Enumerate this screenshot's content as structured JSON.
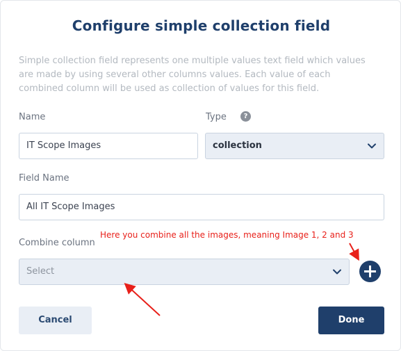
{
  "dialog": {
    "title": "Configure simple collection field",
    "description": "Simple collection field represents one multiple values text field which values are made by using several other columns values. Each value of each combined column will be used as collection of values for this field."
  },
  "form": {
    "name_label": "Name",
    "name_value": "IT Scope Images",
    "type_label": "Type",
    "type_value": "collection",
    "field_name_label": "Field Name",
    "field_name_value": "All IT Scope Images",
    "combine_label": "Combine column",
    "combine_placeholder": "Select"
  },
  "annotation": {
    "text": "Here you combine all the images, meaning Image 1, 2 and 3",
    "color": "#e8201a"
  },
  "buttons": {
    "cancel": "Cancel",
    "done": "Done"
  },
  "icons": {
    "help": "question-circle-icon",
    "help_glyph": "?",
    "chevron": "chevron-down-icon",
    "add": "plus-circle-icon"
  },
  "colors": {
    "primary": "#1f3f6b",
    "select_bg": "#e9eef5",
    "annotation": "#e8201a"
  }
}
